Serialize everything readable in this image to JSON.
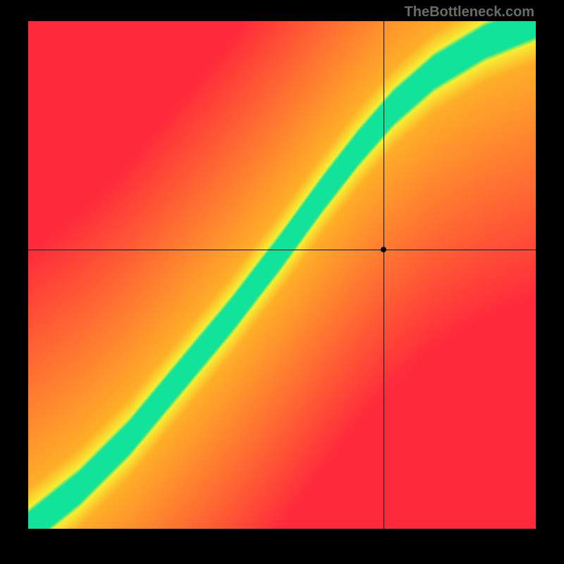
{
  "watermark": "TheBottleneck.com",
  "chart_data": {
    "type": "heatmap",
    "title": "",
    "xlabel": "",
    "ylabel": "",
    "xlim": [
      0,
      100
    ],
    "ylim": [
      0,
      100
    ],
    "crosshair": {
      "x": 70,
      "y": 55
    },
    "optimal_ridge": [
      {
        "x": 0,
        "y": 0
      },
      {
        "x": 10,
        "y": 8
      },
      {
        "x": 20,
        "y": 18
      },
      {
        "x": 30,
        "y": 30
      },
      {
        "x": 40,
        "y": 42
      },
      {
        "x": 50,
        "y": 55
      },
      {
        "x": 58,
        "y": 66
      },
      {
        "x": 65,
        "y": 75
      },
      {
        "x": 72,
        "y": 83
      },
      {
        "x": 80,
        "y": 90
      },
      {
        "x": 90,
        "y": 96
      },
      {
        "x": 100,
        "y": 100
      }
    ],
    "ridge_half_width_pct": 4.0,
    "yellow_band_half_width_pct": 8.0,
    "colors": {
      "optimal": "#12e39a",
      "near": "#f7ef33",
      "mid": "#ffae29",
      "far": "#ff2a3c"
    }
  }
}
